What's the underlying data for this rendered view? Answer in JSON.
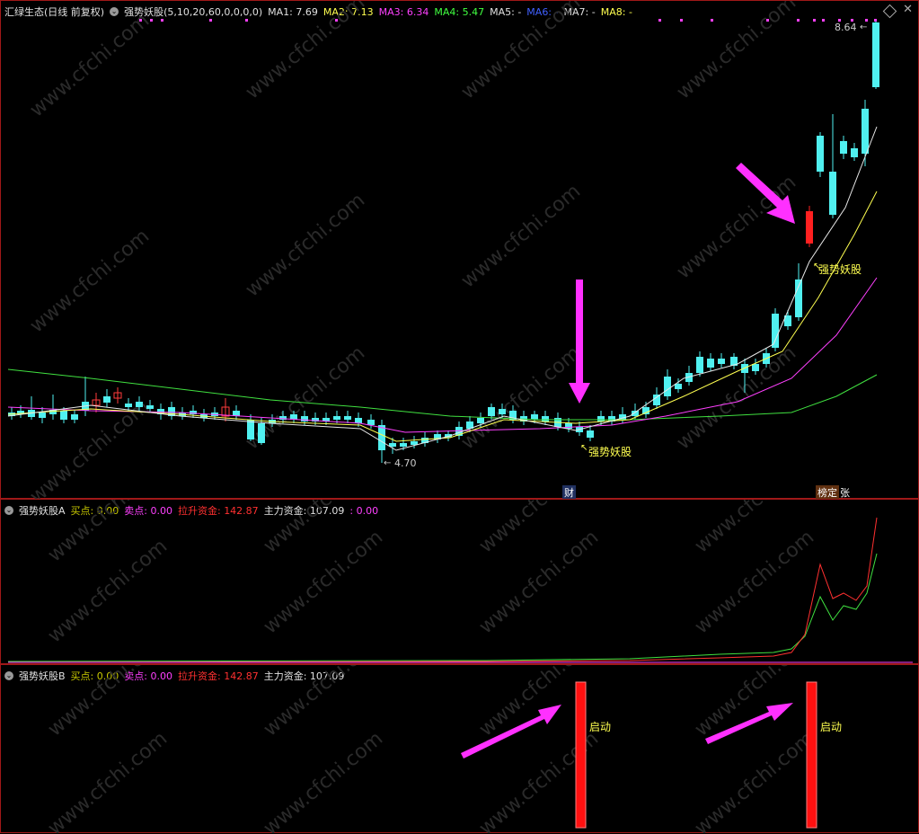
{
  "main": {
    "title": "汇绿生态(日线 前复权)",
    "indicator": "强势妖股(5,10,20,60,0,0,0,0)",
    "ma": [
      {
        "label": "MA1:",
        "value": "7.69",
        "color": "#e0e0e0"
      },
      {
        "label": "MA2:",
        "value": "7.13",
        "color": "#ffff50"
      },
      {
        "label": "MA3:",
        "value": "6.34",
        "color": "#ff40ff"
      },
      {
        "label": "MA4:",
        "value": "5.47",
        "color": "#40ff40"
      },
      {
        "label": "MA5:",
        "value": "-",
        "color": "#e0e0e0"
      },
      {
        "label": "MA6:",
        "value": "-",
        "color": "#4060ff"
      },
      {
        "label": "MA7:",
        "value": "-",
        "color": "#e0e0e0"
      },
      {
        "label": "MA8:",
        "value": "-",
        "color": "#ffff50"
      }
    ],
    "high_label": "8.64",
    "low_label": "4.70",
    "signal_label_1": "强势妖股",
    "signal_label_2": "强势妖股",
    "badge_cai": "财",
    "badge_bang": "榜",
    "badge_ding": "定",
    "badge_zhang": "张"
  },
  "pane_a": {
    "title": "强势妖股A",
    "buy_label": "买点:",
    "buy_value": "0.00",
    "sell_label": "卖点:",
    "sell_value": "0.00",
    "lift_label": "拉升资金:",
    "lift_value": "142.87",
    "main_label": "主力资金:",
    "main_value": "107.09",
    "extra": ": 0.00"
  },
  "pane_b": {
    "title": "强势妖股B",
    "buy_label": "买点:",
    "buy_value": "0.00",
    "sell_label": "卖点:",
    "sell_value": "0.00",
    "lift_label": "拉升资金:",
    "lift_value": "142.87",
    "main_label": "主力资金:",
    "main_value": "107.09",
    "start_1": "启动",
    "start_2": "启动"
  },
  "watermark": "www.cfchi.com"
}
